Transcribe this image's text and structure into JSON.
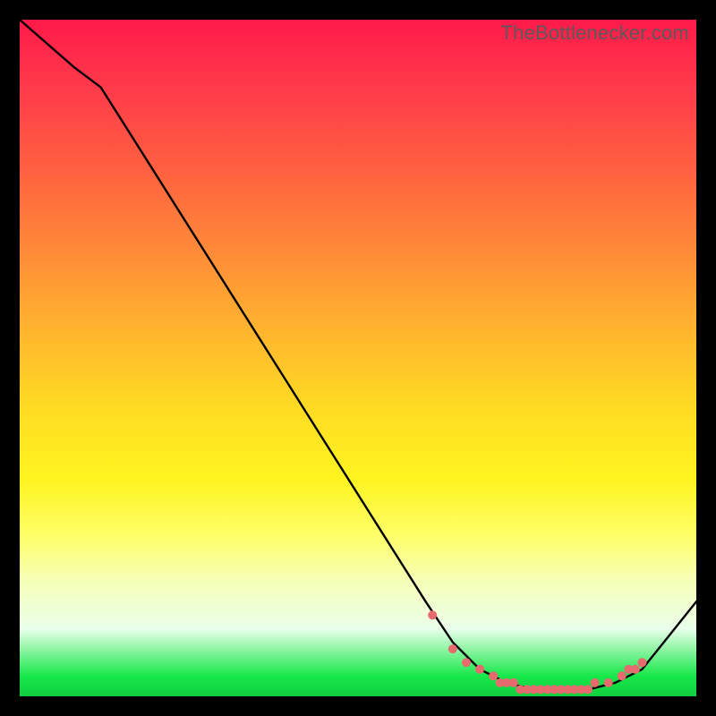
{
  "watermark": "TheBottlenecker.com",
  "chart_data": {
    "type": "line",
    "title": "",
    "xlabel": "",
    "ylabel": "",
    "xlim": [
      0,
      100
    ],
    "ylim": [
      0,
      100
    ],
    "series": [
      {
        "name": "bottleneck-curve",
        "x": [
          0,
          8,
          12,
          60,
          64,
          68,
          72,
          76,
          80,
          84,
          88,
          92,
          96,
          100
        ],
        "values": [
          100,
          93,
          90,
          14,
          8,
          4,
          2,
          1,
          1,
          1,
          2,
          4,
          9,
          14
        ]
      }
    ],
    "markers": {
      "name": "highlight-dots",
      "color": "#e76a6e",
      "x": [
        61,
        64,
        66,
        68,
        70,
        71,
        72,
        73,
        74,
        75,
        76,
        77,
        78,
        79,
        80,
        81,
        82,
        83,
        84,
        85,
        87,
        89,
        90,
        91,
        92
      ],
      "values": [
        12,
        7,
        5,
        4,
        3,
        2,
        2,
        2,
        1,
        1,
        1,
        1,
        1,
        1,
        1,
        1,
        1,
        1,
        1,
        2,
        2,
        3,
        4,
        4,
        5
      ]
    }
  }
}
